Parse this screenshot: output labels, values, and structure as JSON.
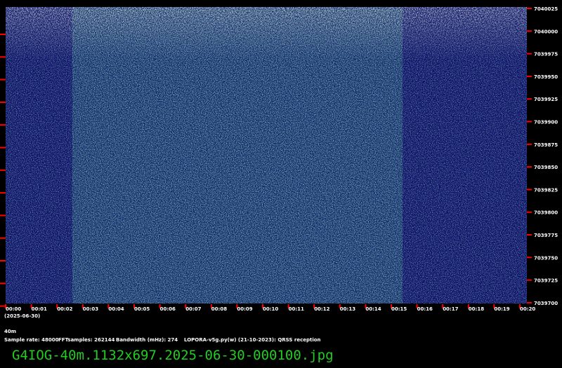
{
  "spectrogram": {
    "frequency_ticks": [
      "7040025",
      "7040000",
      "7039975",
      "7039950",
      "7039925",
      "7039900",
      "7039875",
      "7039850",
      "7039825",
      "7039800",
      "7039775",
      "7039750",
      "7039725",
      "7039700"
    ],
    "time_ticks": [
      "00:00",
      "00:01",
      "00:02",
      "00:03",
      "00:04",
      "00:05",
      "00:06",
      "00:07",
      "00:08",
      "00:09",
      "00:10",
      "00:11",
      "00:12",
      "00:13",
      "00:14",
      "00:15",
      "00:16",
      "00:17",
      "00:18",
      "00:19",
      "00:20"
    ],
    "colors": {
      "background": "#0c0d66",
      "noise": "#2f6f7a",
      "strong": "#b9b9b9",
      "tick": "#ff0000"
    }
  },
  "info": {
    "date": "(2025-06-30)",
    "band": "40m",
    "sample_rate": "Sample rate: 48000",
    "fft_samples": "FFTsamples: 262144",
    "bandwidth": "Bandwidth (mHz): 274",
    "software": "LOPORA-v5g.py(w) (21-10-2023): QRSS reception"
  },
  "filename": "G4IOG-40m.1132x697.2025-06-30-000100.jpg",
  "filename_color": "#22cc22"
}
